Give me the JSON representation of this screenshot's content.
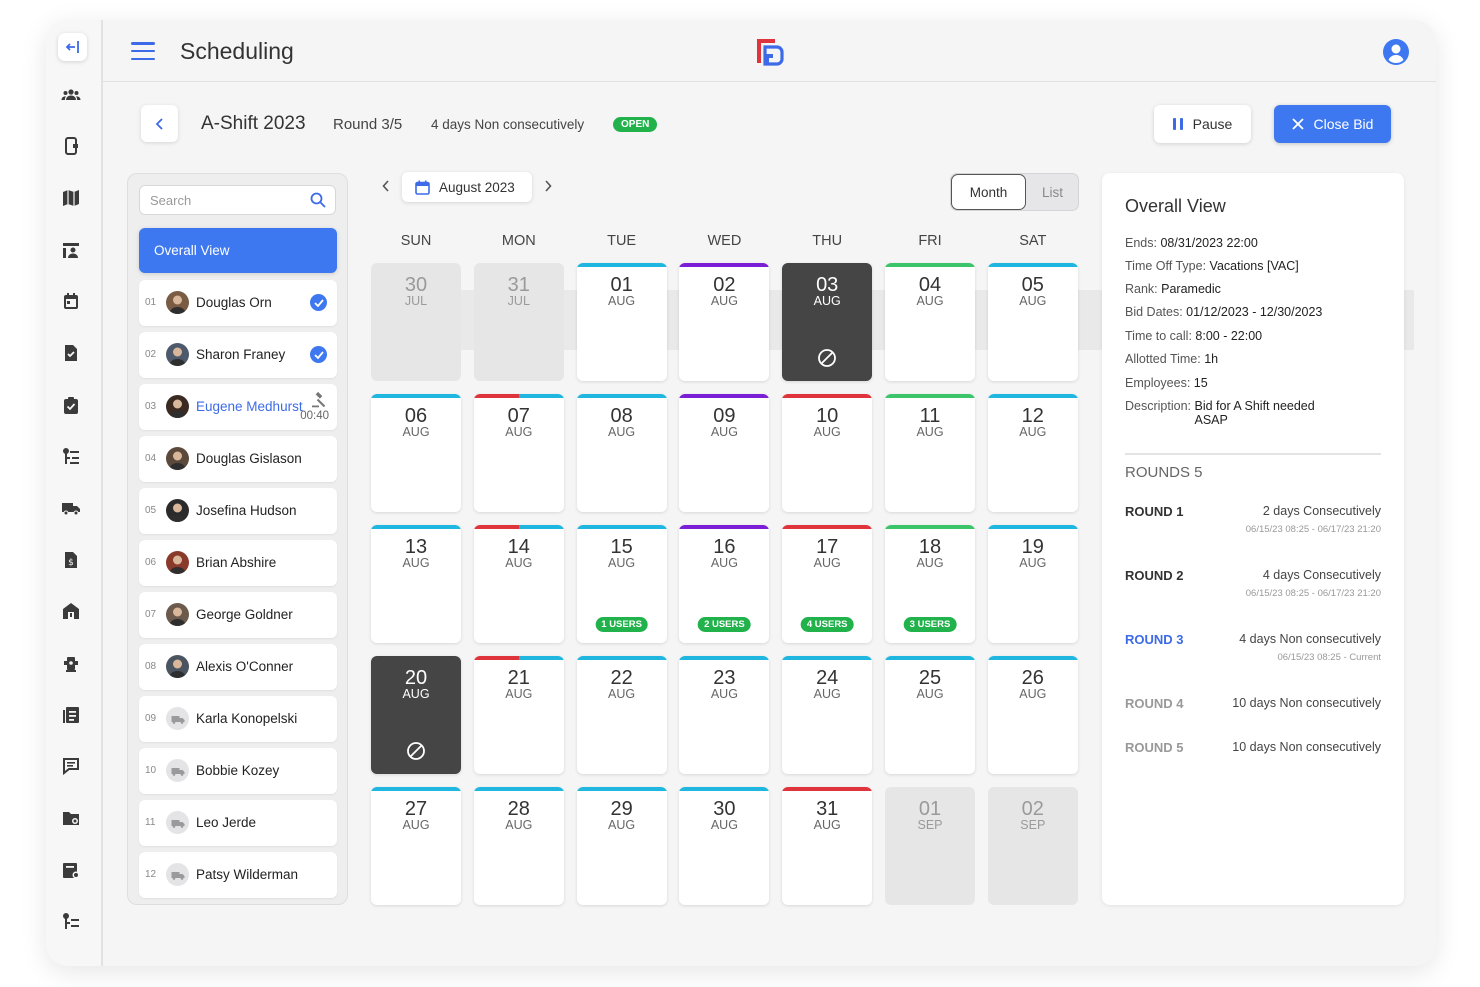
{
  "app": {
    "title": "Scheduling"
  },
  "header": {
    "shift_title": "A-Shift 2023",
    "round": "Round 3/5",
    "bid_type": "4 days Non consecutively",
    "status": "OPEN",
    "pause_label": "Pause",
    "close_label": "Close Bid"
  },
  "search": {
    "placeholder": "Search"
  },
  "employees": {
    "overall_label": "Overall View",
    "items": [
      {
        "num": "01",
        "name": "Douglas Orn",
        "state": "checked"
      },
      {
        "num": "02",
        "name": "Sharon Franey",
        "state": "checked"
      },
      {
        "num": "03",
        "name": "Eugene Medhurst",
        "state": "bidding",
        "timer": "00:40"
      },
      {
        "num": "04",
        "name": "Douglas Gislason",
        "state": ""
      },
      {
        "num": "05",
        "name": "Josefina Hudson",
        "state": ""
      },
      {
        "num": "06",
        "name": "Brian Abshire",
        "state": ""
      },
      {
        "num": "07",
        "name": "George Goldner",
        "state": ""
      },
      {
        "num": "08",
        "name": "Alexis O'Conner",
        "state": ""
      },
      {
        "num": "09",
        "name": "Karla Konopelski",
        "state": ""
      },
      {
        "num": "10",
        "name": "Bobbie Kozey",
        "state": ""
      },
      {
        "num": "11",
        "name": "Leo Jerde",
        "state": ""
      },
      {
        "num": "12",
        "name": "Patsy Wilderman",
        "state": ""
      }
    ]
  },
  "calendar": {
    "month_label": "August 2023",
    "view_month": "Month",
    "view_list": "List",
    "weekdays": [
      "SUN",
      "MON",
      "TUE",
      "WED",
      "THU",
      "FRI",
      "SAT"
    ],
    "colors": {
      "cyan": "#1fb6e0",
      "purple": "#7a1fd6",
      "green": "#3cc46b",
      "red": "#e0343c"
    },
    "days": [
      {
        "d": "30",
        "m": "JUL",
        "out": true,
        "bars": []
      },
      {
        "d": "31",
        "m": "JUL",
        "out": true,
        "bars": []
      },
      {
        "d": "01",
        "m": "AUG",
        "bars": [
          "cyan"
        ]
      },
      {
        "d": "02",
        "m": "AUG",
        "bars": [
          "purple"
        ]
      },
      {
        "d": "03",
        "m": "AUG",
        "blocked": true,
        "bars": []
      },
      {
        "d": "04",
        "m": "AUG",
        "bars": [
          "green"
        ]
      },
      {
        "d": "05",
        "m": "AUG",
        "bars": [
          "cyan"
        ]
      },
      {
        "d": "06",
        "m": "AUG",
        "bars": [
          "cyan"
        ]
      },
      {
        "d": "07",
        "m": "AUG",
        "bars": [
          "red",
          "cyan"
        ]
      },
      {
        "d": "08",
        "m": "AUG",
        "bars": [
          "cyan"
        ]
      },
      {
        "d": "09",
        "m": "AUG",
        "bars": [
          "purple"
        ]
      },
      {
        "d": "10",
        "m": "AUG",
        "bars": [
          "red"
        ]
      },
      {
        "d": "11",
        "m": "AUG",
        "bars": [
          "green"
        ]
      },
      {
        "d": "12",
        "m": "AUG",
        "bars": [
          "cyan"
        ]
      },
      {
        "d": "13",
        "m": "AUG",
        "bars": [
          "cyan"
        ]
      },
      {
        "d": "14",
        "m": "AUG",
        "bars": [
          "red",
          "cyan"
        ]
      },
      {
        "d": "15",
        "m": "AUG",
        "bars": [
          "cyan"
        ],
        "users": "1 USERS"
      },
      {
        "d": "16",
        "m": "AUG",
        "bars": [
          "purple"
        ],
        "users": "2 USERS"
      },
      {
        "d": "17",
        "m": "AUG",
        "bars": [
          "red"
        ],
        "users": "4 USERS"
      },
      {
        "d": "18",
        "m": "AUG",
        "bars": [
          "green"
        ],
        "users": "3 USERS"
      },
      {
        "d": "19",
        "m": "AUG",
        "bars": [
          "cyan"
        ]
      },
      {
        "d": "20",
        "m": "AUG",
        "blocked": true,
        "bars": []
      },
      {
        "d": "21",
        "m": "AUG",
        "bars": [
          "red",
          "cyan"
        ]
      },
      {
        "d": "22",
        "m": "AUG",
        "bars": [
          "cyan"
        ]
      },
      {
        "d": "23",
        "m": "AUG",
        "bars": [
          "cyan"
        ]
      },
      {
        "d": "24",
        "m": "AUG",
        "bars": [
          "cyan"
        ]
      },
      {
        "d": "25",
        "m": "AUG",
        "bars": [
          "cyan"
        ]
      },
      {
        "d": "26",
        "m": "AUG",
        "bars": [
          "cyan"
        ]
      },
      {
        "d": "27",
        "m": "AUG",
        "bars": [
          "cyan"
        ]
      },
      {
        "d": "28",
        "m": "AUG",
        "bars": [
          "cyan"
        ]
      },
      {
        "d": "29",
        "m": "AUG",
        "bars": [
          "cyan"
        ]
      },
      {
        "d": "30",
        "m": "AUG",
        "bars": [
          "cyan"
        ]
      },
      {
        "d": "31",
        "m": "AUG",
        "bars": [
          "red"
        ]
      },
      {
        "d": "01",
        "m": "SEP",
        "out": true,
        "bars": []
      },
      {
        "d": "02",
        "m": "SEP",
        "out": true,
        "bars": []
      }
    ]
  },
  "overall": {
    "title": "Overall View",
    "fields": [
      {
        "label": "Ends:",
        "value": "08/31/2023 22:00"
      },
      {
        "label": "Time Off Type:",
        "value": "Vacations [VAC]"
      },
      {
        "label": "Rank:",
        "value": "Paramedic"
      },
      {
        "label": "Bid Dates:",
        "value": "01/12/2023 - 12/30/2023"
      },
      {
        "label": "Time to call:",
        "value": "8:00 - 22:00"
      },
      {
        "label": "Allotted Time:",
        "value": "1h"
      },
      {
        "label": "Employees:",
        "value": "15"
      },
      {
        "label": "Description:",
        "value": "Bid for A Shift needed ASAP"
      }
    ],
    "rounds_title": "ROUNDS 5",
    "rounds": [
      {
        "label": "ROUND 1",
        "desc": "2 days Consecutively",
        "time": "06/15/23  08:25 - 06/17/23 21:20",
        "state": "done"
      },
      {
        "label": "ROUND 2",
        "desc": "4 days Consecutively",
        "time": "06/15/23  08:25 - 06/17/23 21:20",
        "state": "done"
      },
      {
        "label": "ROUND 3",
        "desc": "4 days Non consecutively",
        "time": "06/15/23  08:25 - Current",
        "state": "current"
      },
      {
        "label": "ROUND 4",
        "desc": "10 days Non consecutively",
        "time": "",
        "state": "future"
      },
      {
        "label": "ROUND 5",
        "desc": "10 days Non consecutively",
        "time": "",
        "state": "future"
      }
    ]
  }
}
